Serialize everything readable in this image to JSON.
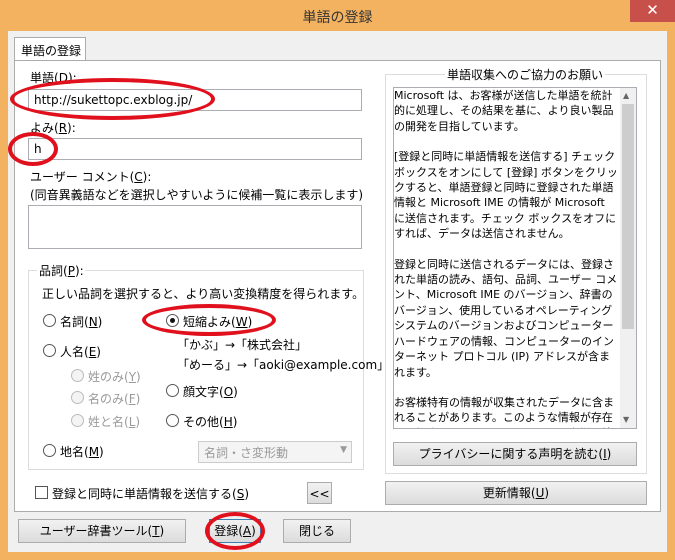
{
  "window": {
    "title": "単語の登録",
    "close_glyph": "✕"
  },
  "tab": {
    "label": "単語の登録"
  },
  "word": {
    "label": "単語(",
    "key": "D",
    "label_end": "):",
    "value": "http://sukettopc.exblog.jp/"
  },
  "reading": {
    "label": "よみ(",
    "key": "R",
    "label_end": "):",
    "value": "h"
  },
  "comment": {
    "label": "ユーザー コメント(",
    "key": "C",
    "label_end": "):",
    "hint": "(同音異義語などを選択しやすいように候補一覧に表示します)",
    "value": ""
  },
  "pos": {
    "caption_prefix": "品詞(",
    "caption_key": "P",
    "caption_suffix": "):",
    "desc": "正しい品詞を選択すると、より高い変換精度を得られます。",
    "noun": {
      "text": "名詞(",
      "key": "N",
      "end": ")"
    },
    "shortcut": {
      "text": "短縮よみ(",
      "key": "W",
      "end": ")"
    },
    "shortcut_example1": "「かぶ」→「株式会社」",
    "shortcut_example2": "「めーる」→「aoki@example.com」",
    "person": {
      "text": "人名(",
      "key": "E",
      "end": ")"
    },
    "surname": {
      "text": "姓のみ(",
      "key": "Y",
      "end": ")"
    },
    "given": {
      "text": "名のみ(",
      "key": "F",
      "end": ")"
    },
    "fullname": {
      "text": "姓と名(",
      "key": "L",
      "end": ")"
    },
    "emoticon": {
      "text": "顔文字(",
      "key": "O",
      "end": ")"
    },
    "other": {
      "text": "その他(",
      "key": "H",
      "end": ")"
    },
    "place": {
      "text": "地名(",
      "key": "M",
      "end": ")"
    },
    "select_value": "名詞・さ変形動",
    "selected": "短縮よみ"
  },
  "send_info": {
    "text": "登録と同時に単語情報を送信する(",
    "key": "S",
    "end": ")",
    "checked": false
  },
  "collapse_button": "<<",
  "info_group": {
    "caption": "単語収集へのご協力のお願い",
    "para1": "Microsoft は、お客様が送信した単語を統計的に処理し、その結果を基に、より良い製品の開発を目指しています。",
    "para2": "[登録と同時に単語情報を送信する] チェック ボックスをオンにして [登録] ボタンをクリックすると、単語登録と同時に登録された単語情報と Microsoft IME の情報が Microsoft に送信されます。チェック ボックスをオフにすれば、データは送信されません。",
    "para3": "登録と同時に送信されるデータには、登録された単語の読み、語句、品詞、ユーザー コメント、Microsoft IME のバージョン、辞書のバージョン、使用しているオペレーティング システムのバージョンおよびコンピューター ハードウェアの情報、コンピューターのインターネット プロトコル (IP) アドレスが含まれます。",
    "para4": "お客様特有の情報が収集されたデータに含まれることがあります。このような情報が存在する場合でも、Microsoft では、お客様を特定す",
    "privacy_button": "プライバシーに関する声明を読む(",
    "privacy_key": "I",
    "privacy_end": ")",
    "update_button": "更新情報(",
    "update_key": "U",
    "update_end": ")"
  },
  "footer": {
    "dict_tool_text": "ユーザー辞書ツール(",
    "dict_tool_key": "T",
    "dict_tool_end": ")",
    "register_text": "登録(",
    "register_key": "A",
    "register_end": ")",
    "close": "閉じる"
  },
  "colors": {
    "title_bar": "#f3b25f",
    "close_button": "#c7504b",
    "annotation": "#e0101c"
  }
}
